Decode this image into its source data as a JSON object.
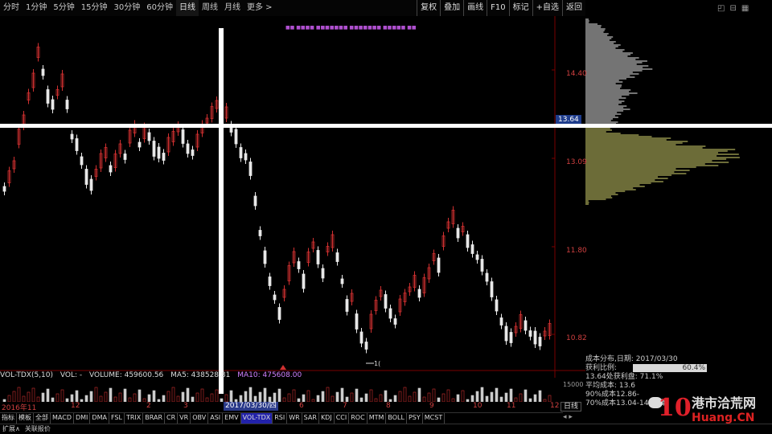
{
  "periods": [
    "分时",
    "1分钟",
    "5分钟",
    "15分钟",
    "30分钟",
    "60分钟",
    "日线",
    "周线",
    "月线",
    "更多 >"
  ],
  "active_period": "日线",
  "right_tools": [
    "复权",
    "叠加",
    "画线",
    "F10",
    "标记",
    "+自选",
    "返回"
  ],
  "price_axis": [
    "14.40",
    "13.09",
    "11.80",
    "10.82"
  ],
  "current_price": "13.64",
  "x_labels": [
    "2016年11",
    "12",
    "2",
    "3",
    "6",
    "7",
    "8",
    "9",
    "10",
    "11",
    "12"
  ],
  "selected_date": "2017/03/30/四",
  "low_marker": "1(",
  "volume": {
    "label": "VOL-TDX(5,10)",
    "vol_text": "VOL: -",
    "volume_text": "VOLUME: 459600.56",
    "ma5_text": "MA5: 438528.81",
    "ma10_text": "MA10: 475608.00",
    "axis_value": "15000"
  },
  "indicator_tabs": [
    "指标",
    "模板",
    "全部",
    "MACD",
    "DMI",
    "DMA",
    "FSL",
    "TRIX",
    "BRAR",
    "CR",
    "VR",
    "OBV",
    "ASI",
    "EMV",
    "VOL-TDX",
    "RSI",
    "WR",
    "SAR",
    "KDJ",
    "CCI",
    "ROC",
    "MTM",
    "BOLL",
    "PSY",
    "MCST"
  ],
  "active_indicator": "VOL-TDX",
  "day_button": "日线",
  "bottom_tabs": [
    "扩展∧",
    "关联报价"
  ],
  "info_panel": {
    "title": "成本分布,日期: 2017/03/30",
    "win_label": "获利比例:",
    "win_value": "60.4%",
    "win_fraction": 0.604,
    "line2": "13.64处获利盘: 71.1%",
    "line3": "平均成本: 13.6",
    "line4": "90%成本12.86-",
    "line5": "70%成本13.04-14.16集"
  },
  "watermark": {
    "num": "10",
    "cn": "港市洽荒网",
    "url": "Huang.CN"
  },
  "colors": {
    "up": "#d03030",
    "down": "#e8e8e8",
    "upper_profile": "#e8e8e8",
    "lower_profile": "#d8d870",
    "accent": "#1e3c8c"
  }
}
